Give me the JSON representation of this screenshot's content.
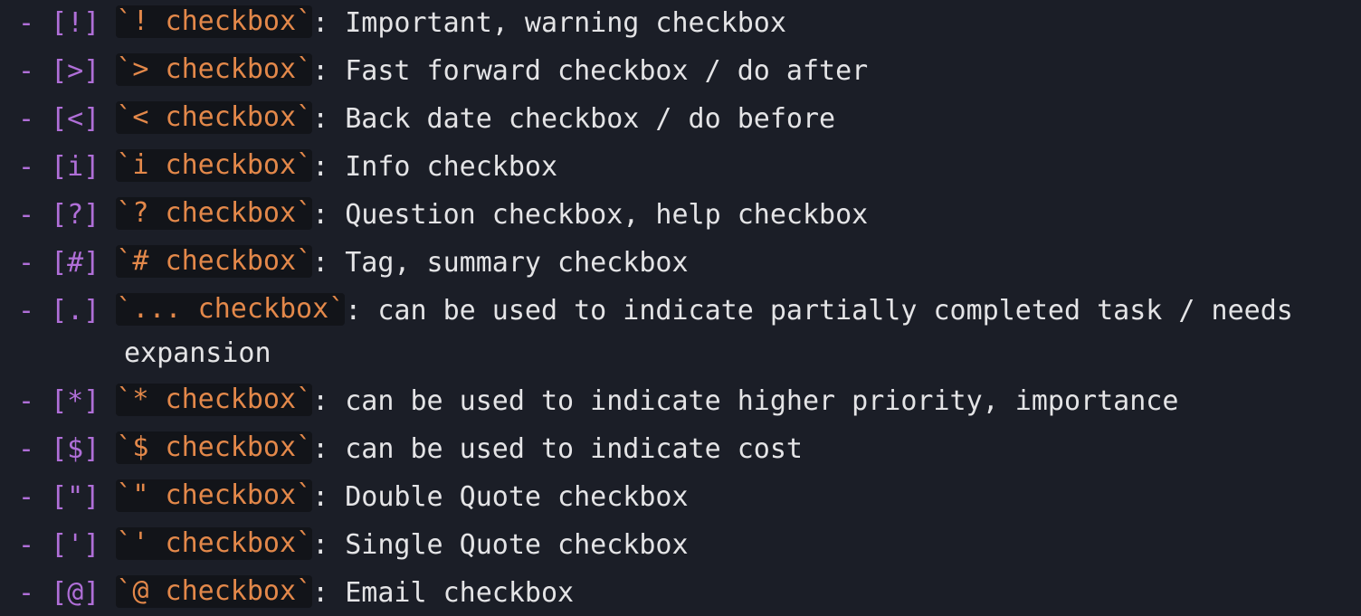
{
  "editor": {
    "accent_colors": {
      "marker": "#b06fd8",
      "inline_code": "#e3884a",
      "code_background": "#121419",
      "text": "#e4e4e6",
      "background": "#1b1e27"
    },
    "lines": [
      {
        "dash": "-",
        "marker": "[!]",
        "code": "`! checkbox`",
        "desc": ": Important, warning checkbox"
      },
      {
        "dash": "-",
        "marker": "[>]",
        "code": "`> checkbox`",
        "desc": ": Fast forward checkbox / do after"
      },
      {
        "dash": "-",
        "marker": "[<]",
        "code": "`< checkbox`",
        "desc": ": Back date checkbox / do before"
      },
      {
        "dash": "-",
        "marker": "[i]",
        "code": "`i checkbox`",
        "desc": ": Info checkbox"
      },
      {
        "dash": "-",
        "marker": "[?]",
        "code": "`? checkbox`",
        "desc": ": Question checkbox, help checkbox"
      },
      {
        "dash": "-",
        "marker": "[#]",
        "code": "`# checkbox`",
        "desc": ": Tag, summary checkbox"
      },
      {
        "dash": "-",
        "marker": "[.]",
        "code": "`... checkbox`",
        "desc": ": can be used to indicate partially completed task / needs",
        "continuation": "expansion"
      },
      {
        "dash": "-",
        "marker": "[*]",
        "code": "`* checkbox`",
        "desc": ": can be used to indicate higher priority, importance"
      },
      {
        "dash": "-",
        "marker": "[$]",
        "code": "`$ checkbox`",
        "desc": ": can be used to indicate cost"
      },
      {
        "dash": "-",
        "marker": "[\"]",
        "code": "`\" checkbox`",
        "desc": ": Double Quote checkbox"
      },
      {
        "dash": "-",
        "marker": "[']",
        "code": "`' checkbox`",
        "desc": ": Single Quote checkbox"
      },
      {
        "dash": "-",
        "marker": "[@]",
        "code": "`@ checkbox`",
        "desc": ": Email checkbox"
      }
    ]
  }
}
